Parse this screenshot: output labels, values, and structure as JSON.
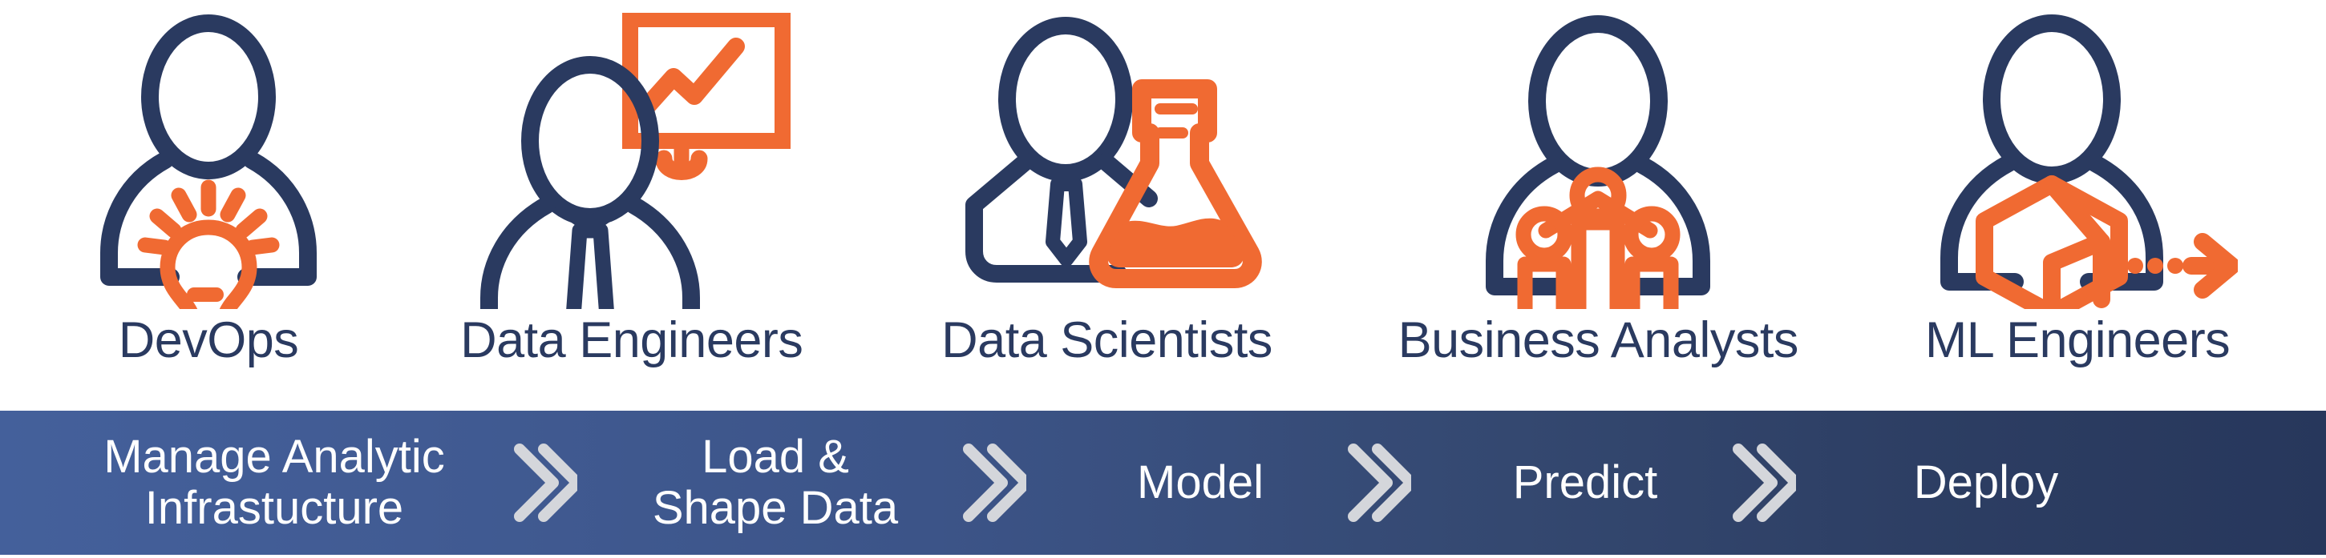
{
  "theme": {
    "navy": "#2A3A60",
    "orange": "#F06A32",
    "bar_gradient_start": "#44609B",
    "bar_gradient_end": "#27375C",
    "chevron_color": "#D4D6DB",
    "stage_text_color": "#FFFFFF",
    "background": "#FFFFFF"
  },
  "roles": [
    {
      "label": "DevOps",
      "icon": "person-lightbulb-icon"
    },
    {
      "label": "Data Engineers",
      "icon": "person-presentation-chart-icon"
    },
    {
      "label": "Data Scientists",
      "icon": "person-flask-icon"
    },
    {
      "label": "Business Analysts",
      "icon": "person-bar-chart-icon"
    },
    {
      "label": "ML Engineers",
      "icon": "person-cube-arrow-icon"
    }
  ],
  "process_bar": {
    "stages": [
      {
        "label": "Manage Analytic\nInfrastucture"
      },
      {
        "label": "Load &\nShape Data"
      },
      {
        "label": "Model"
      },
      {
        "label": "Predict"
      },
      {
        "label": "Deploy"
      }
    ],
    "separator_icon": "double-chevron-right-icon"
  }
}
